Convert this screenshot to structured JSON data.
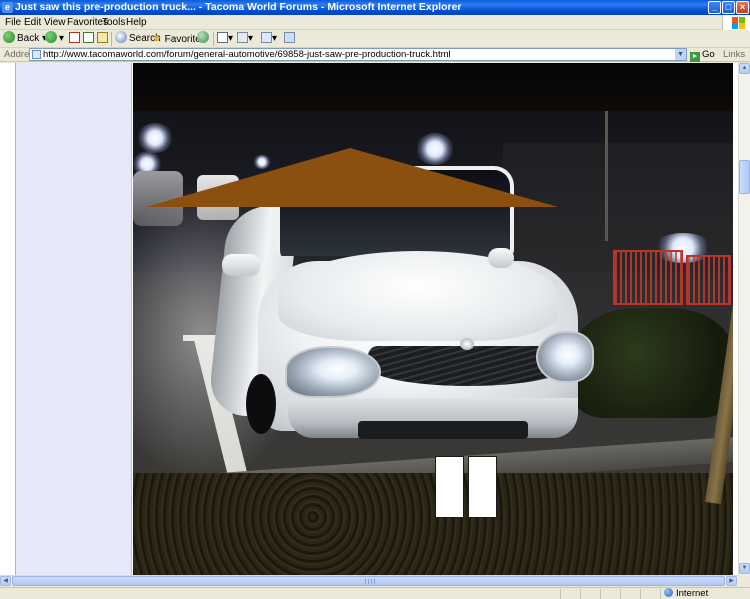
{
  "window": {
    "title": "Just saw this pre-production truck... - Tacoma World Forums - Microsoft Internet Explorer",
    "minimize": "_",
    "maximize": "□",
    "close": "×"
  },
  "menu": {
    "items": [
      "File",
      "Edit",
      "View",
      "Favorites",
      "Tools",
      "Help"
    ]
  },
  "toolbar": {
    "back_label": "Back",
    "search_label": "Search",
    "favorites_label": "Favorites"
  },
  "address": {
    "label": "Address",
    "url": "http://www.tacomaworld.com/forum/general-automotive/69858-just-saw-pre-production-truck.html",
    "go_label": "Go",
    "links_label": "Links"
  },
  "status": {
    "zone": "Internet"
  },
  "colors": {
    "roof_overlay": "#8b5010",
    "plate_overlay": "#ffffff",
    "title_bar": "#0a5cdc"
  },
  "icons": [
    "back-arrow-icon",
    "forward-arrow-icon",
    "stop-icon",
    "refresh-icon",
    "home-icon",
    "search-icon",
    "favorites-star-icon",
    "history-icon",
    "mail-icon",
    "print-icon",
    "edit-icon",
    "messenger-icon",
    "page-icon",
    "go-arrow-icon",
    "globe-icon"
  ]
}
